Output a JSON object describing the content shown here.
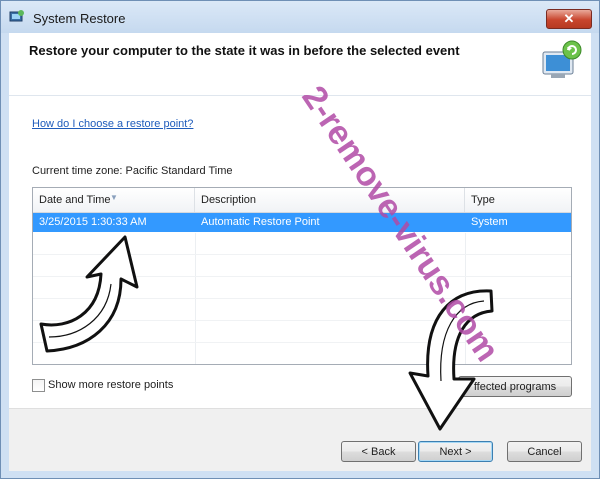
{
  "window": {
    "title": "System Restore",
    "close_label": "✕"
  },
  "header": {
    "heading": "Restore your computer to the state it was in before the selected event"
  },
  "help_link": "How do I choose a restore point?",
  "timezone": "Current time zone: Pacific Standard Time",
  "table": {
    "columns": [
      "Date and Time",
      "Description",
      "Type"
    ],
    "rows": [
      {
        "date": "3/25/2015 1:30:33 AM",
        "description": "Automatic Restore Point",
        "type": "System"
      }
    ]
  },
  "show_more_label": "Show more restore points",
  "buttons": {
    "affected": "ffected programs",
    "back": "< Back",
    "next": "Next >",
    "cancel": "Cancel"
  },
  "watermark": "2-remove-virus.com",
  "colors": {
    "selection": "#3399ff",
    "link": "#1f5cbb",
    "watermark": "#b04aa6"
  }
}
